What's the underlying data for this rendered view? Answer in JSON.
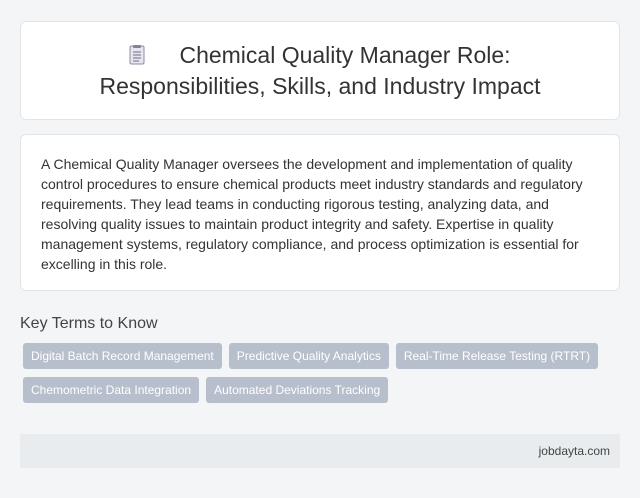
{
  "header": {
    "icon": "document-icon",
    "title": "Chemical Quality Manager Role: Responsibilities, Skills, and Industry Impact"
  },
  "description": {
    "text": "A Chemical Quality Manager oversees the development and implementation of quality control procedures to ensure chemical products meet industry standards and regulatory requirements. They lead teams in conducting rigorous testing, analyzing data, and resolving quality issues to maintain product integrity and safety. Expertise in quality management systems, regulatory compliance, and process optimization is essential for excelling in this role."
  },
  "key_terms": {
    "heading": "Key Terms to Know",
    "tags": [
      "Digital Batch Record Management",
      "Predictive Quality Analytics",
      "Real-Time Release Testing (RTRT)",
      "Chemometric Data Integration",
      "Automated Deviations Tracking"
    ]
  },
  "footer": {
    "site": "jobdayta.com"
  },
  "colors": {
    "background": "#f4f5f6",
    "card": "#ffffff",
    "tag": "#b8bfcc",
    "footer": "#e8ecee"
  }
}
